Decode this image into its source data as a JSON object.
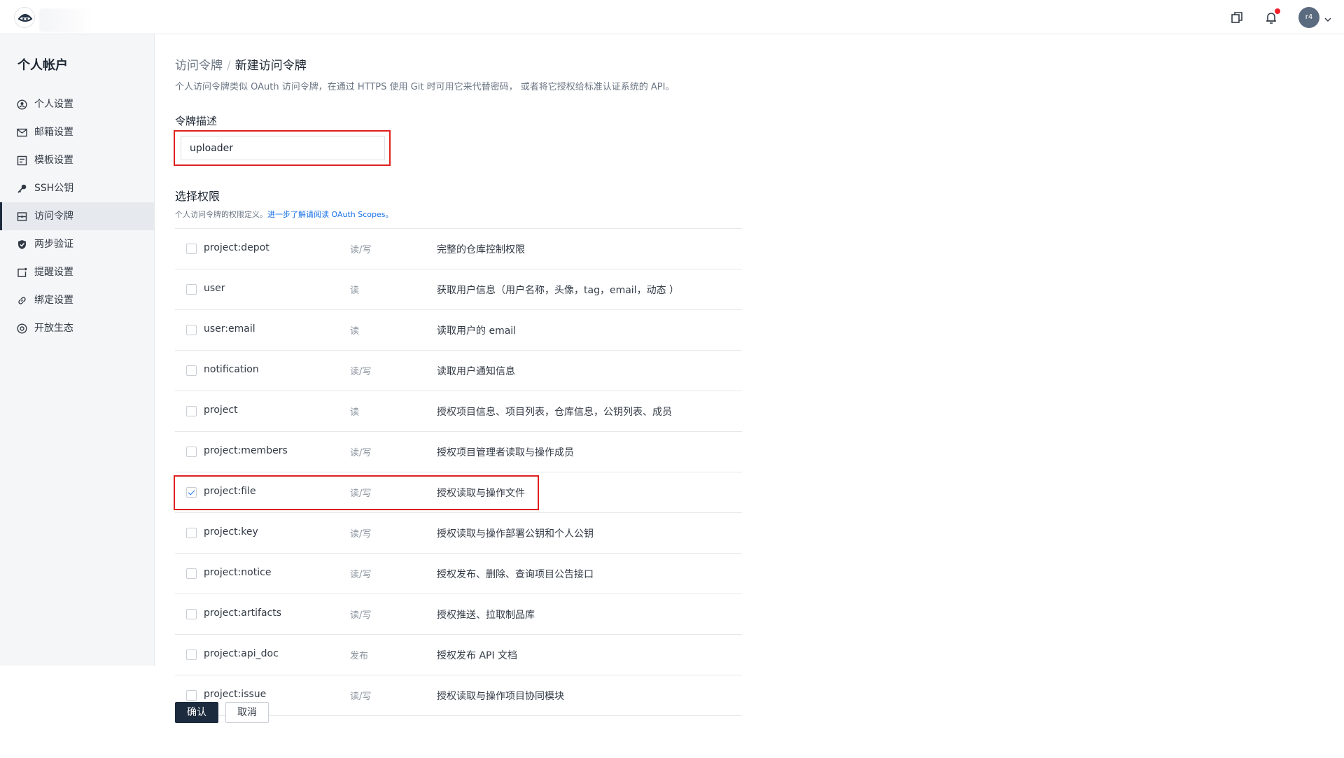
{
  "header": {
    "logo_icon": "mascot-logo-icon",
    "actions": [
      {
        "icon": "copy-window-icon"
      },
      {
        "icon": "bell-icon",
        "has_notification": true
      },
      {
        "icon": "user-avatar",
        "label": "r4"
      }
    ]
  },
  "sidebar": {
    "title": "个人帐户",
    "items": [
      {
        "label": "个人设置",
        "icon": "user-circle-icon"
      },
      {
        "label": "邮箱设置",
        "icon": "mail-icon"
      },
      {
        "label": "模板设置",
        "icon": "template-icon"
      },
      {
        "label": "SSH公钥",
        "icon": "key-icon"
      },
      {
        "label": "访问令牌",
        "icon": "token-icon",
        "active": true
      },
      {
        "label": "两步验证",
        "icon": "shield-check-icon"
      },
      {
        "label": "提醒设置",
        "icon": "reminder-icon"
      },
      {
        "label": "绑定设置",
        "icon": "link-icon"
      },
      {
        "label": "开放生态",
        "icon": "ecosystem-icon"
      }
    ]
  },
  "main": {
    "breadcrumb": {
      "parent": "访问令牌",
      "separator": "/",
      "current": "新建访问令牌"
    },
    "description": "个人访问令牌类似 OAuth 访问令牌，在通过 HTTPS 使用 Git 时可用它来代替密码， 或者将它授权给标准认证系统的 API。",
    "token_field": {
      "label": "令牌描述",
      "value": "uploader"
    },
    "permissions": {
      "title": "选择权限",
      "desc_prefix": "个人访问令牌的权限定义。",
      "desc_link": "进一步了解请阅读 OAuth Scopes。",
      "rows": [
        {
          "scope": "project:depot",
          "access": "读/写",
          "desc": "完整的仓库控制权限",
          "checked": false
        },
        {
          "scope": "user",
          "access": "读",
          "desc": "获取用户信息（用户名称，头像，tag，email，动态 ）",
          "checked": false
        },
        {
          "scope": "user:email",
          "access": "读",
          "desc": "读取用户的 email",
          "checked": false
        },
        {
          "scope": "notification",
          "access": "读/写",
          "desc": "读取用户通知信息",
          "checked": false
        },
        {
          "scope": "project",
          "access": "读",
          "desc": "授权项目信息、项目列表，仓库信息，公钥列表、成员",
          "checked": false
        },
        {
          "scope": "project:members",
          "access": "读/写",
          "desc": "授权项目管理者读取与操作成员",
          "checked": false
        },
        {
          "scope": "project:file",
          "access": "读/写",
          "desc": "授权读取与操作文件",
          "checked": true
        },
        {
          "scope": "project:key",
          "access": "读/写",
          "desc": "授权读取与操作部署公钥和个人公钥",
          "checked": false
        },
        {
          "scope": "project:notice",
          "access": "读/写",
          "desc": "授权发布、删除、查询项目公告接口",
          "checked": false
        },
        {
          "scope": "project:artifacts",
          "access": "读/写",
          "desc": "授权推送、拉取制品库",
          "checked": false
        },
        {
          "scope": "project:api_doc",
          "access": "发布",
          "desc": "授权发布 API 文档",
          "checked": false
        },
        {
          "scope": "project:issue",
          "access": "读/写",
          "desc": "授权读取与操作项目协同模块",
          "checked": false
        }
      ]
    },
    "buttons": {
      "confirm": "确认",
      "cancel": "取消"
    }
  },
  "colors": {
    "accent": "#1a73e8",
    "primary_button": "#1c2b3d",
    "highlight": "#e02020",
    "notification": "#f5222d"
  }
}
